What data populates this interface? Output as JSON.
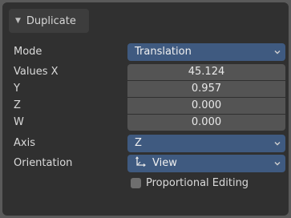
{
  "panel": {
    "title": "Duplicate",
    "collapse_icon": "triangle-down-icon"
  },
  "mode": {
    "label": "Mode",
    "value": "Translation"
  },
  "values": {
    "label_x": "Values X",
    "label_y": "Y",
    "label_z": "Z",
    "label_w": "W",
    "x": "45.124",
    "y": "0.957",
    "z": "0.000",
    "w": "0.000"
  },
  "axis": {
    "label": "Axis",
    "value": "Z"
  },
  "orientation": {
    "label": "Orientation",
    "value": "View",
    "icon": "orientation-axes-icon"
  },
  "proportional_editing": {
    "label": "Proportional Editing",
    "checked": false
  },
  "colors": {
    "panel_bg": "#303030",
    "dropdown_bg": "#3f5a80",
    "field_bg": "#545454",
    "outer_bg": "#5a5a5a"
  }
}
